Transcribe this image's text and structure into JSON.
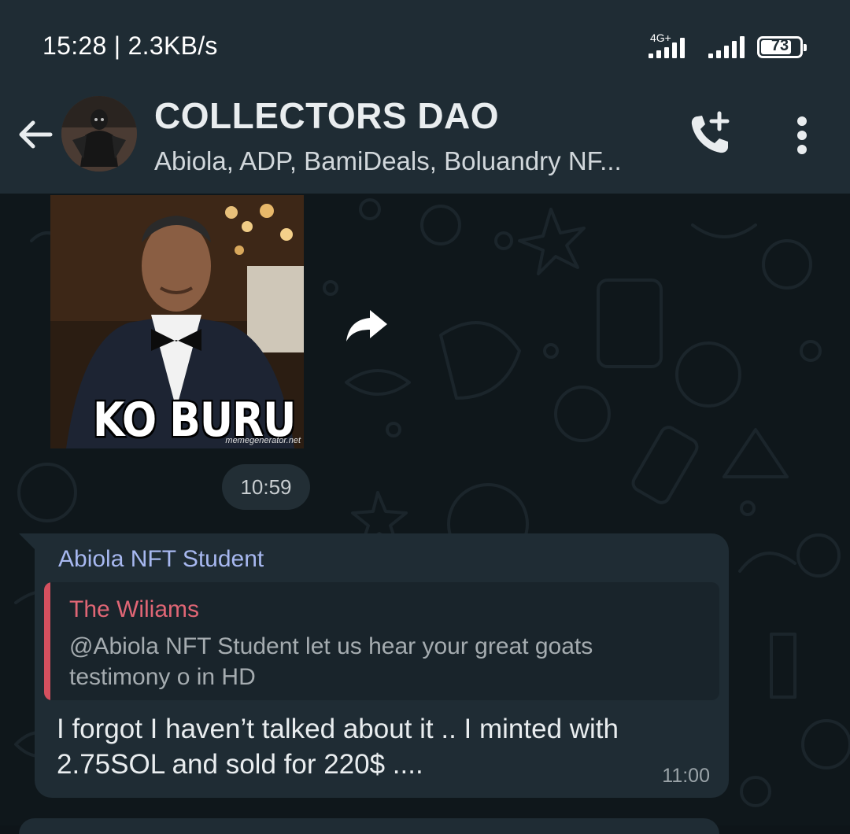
{
  "status_bar": {
    "time": "15:28 | 2.3KB/s",
    "network_label": "4G+",
    "battery": "73"
  },
  "header": {
    "title": "COLLECTORS DAO",
    "members": "Abiola, ADP, BamiDeals, Boluandry NF..."
  },
  "image_message": {
    "caption": "KO BURU",
    "watermark": "memegenerator.net",
    "time": "10:59"
  },
  "text_message": {
    "sender": "Abiola NFT Student",
    "quote_author": "The Wiliams",
    "quote_text": "@Abiola NFT Student let us hear your great goats testimony o in HD",
    "body": "I forgot I haven’t talked about it .. I minted with 2.75SOL and sold for 220$   ....",
    "time": "11:00"
  },
  "colors": {
    "header_bg": "#1f2c34",
    "chat_bg": "#0f171b",
    "bubble_bg": "#1f2c34",
    "sender_color": "#a7b8f0",
    "quote_accent": "#d5505f"
  },
  "icons": [
    "back-arrow-icon",
    "add-call-icon",
    "more-vertical-icon",
    "forward-icon",
    "signal-icon",
    "battery-icon"
  ]
}
